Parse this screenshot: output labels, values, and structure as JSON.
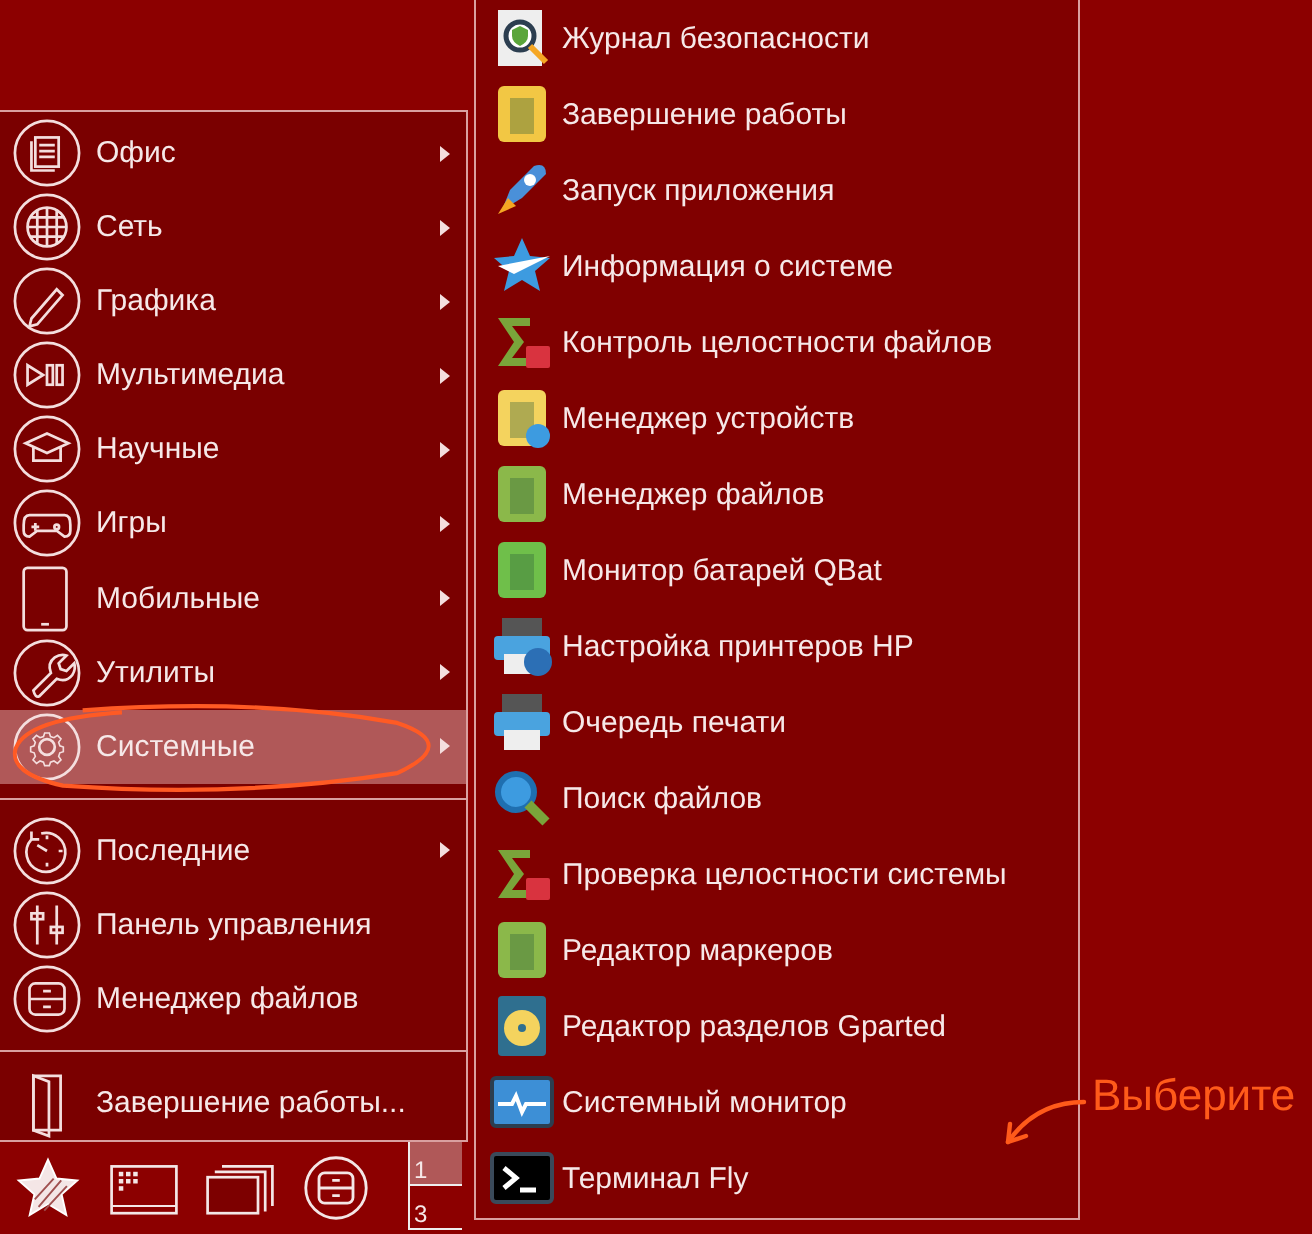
{
  "main_menu": {
    "sections": [
      {
        "items": [
          {
            "label": "Офис",
            "has_submenu": true,
            "selected": false,
            "circled": false
          },
          {
            "label": "Сеть",
            "has_submenu": true,
            "selected": false,
            "circled": false
          },
          {
            "label": "Графика",
            "has_submenu": true,
            "selected": false,
            "circled": false
          },
          {
            "label": "Мультимедиа",
            "has_submenu": true,
            "selected": false,
            "circled": false
          },
          {
            "label": "Научные",
            "has_submenu": true,
            "selected": false,
            "circled": false
          },
          {
            "label": "Игры",
            "has_submenu": true,
            "selected": false,
            "circled": false
          },
          {
            "label": "Мобильные",
            "has_submenu": true,
            "selected": false,
            "circled": false
          },
          {
            "label": "Утилиты",
            "has_submenu": true,
            "selected": false,
            "circled": false
          },
          {
            "label": "Системные",
            "has_submenu": true,
            "selected": true,
            "circled": true
          }
        ]
      },
      {
        "items": [
          {
            "label": "Последние",
            "has_submenu": true,
            "selected": false,
            "circled": false
          },
          {
            "label": "Панель управления",
            "has_submenu": false,
            "selected": false,
            "circled": false
          },
          {
            "label": "Менеджер файлов",
            "has_submenu": false,
            "selected": false,
            "circled": false
          }
        ]
      },
      {
        "items": [
          {
            "label": "Завершение работы...",
            "has_submenu": false,
            "selected": false,
            "circled": false
          }
        ]
      }
    ]
  },
  "submenu": {
    "items": [
      {
        "label": "Журнал безопасности"
      },
      {
        "label": "Завершение работы"
      },
      {
        "label": "Запуск приложения"
      },
      {
        "label": "Информация о системе"
      },
      {
        "label": "Контроль целостности файлов"
      },
      {
        "label": "Менеджер устройств"
      },
      {
        "label": "Менеджер файлов"
      },
      {
        "label": "Монитор батарей QBat"
      },
      {
        "label": "Настройка принтеров HP"
      },
      {
        "label": "Очередь печати"
      },
      {
        "label": "Поиск файлов"
      },
      {
        "label": "Проверка целостности системы"
      },
      {
        "label": "Редактор маркеров"
      },
      {
        "label": "Редактор разделов Gparted"
      },
      {
        "label": "Системный монитор"
      },
      {
        "label": "Терминал Fly"
      }
    ]
  },
  "taskbar": {
    "pager": [
      {
        "label": "1",
        "selected": true
      },
      {
        "label": "3",
        "selected": false
      }
    ]
  },
  "annotation": {
    "text": "Выберите"
  }
}
